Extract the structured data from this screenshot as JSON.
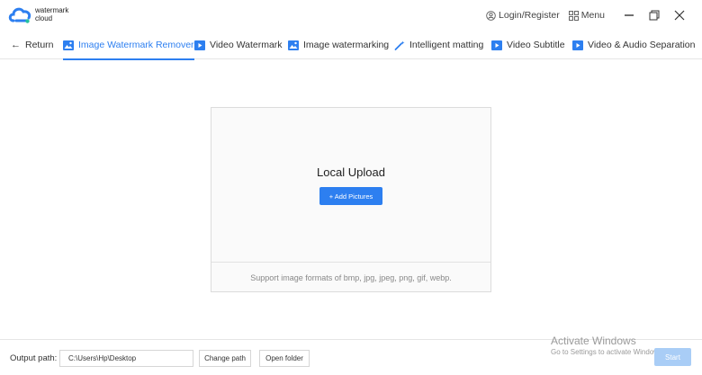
{
  "brand": {
    "line1": "watermark",
    "line2": "cloud",
    "color": "#2d7ff0"
  },
  "header": {
    "login_label": "Login/Register",
    "menu_label": "Menu"
  },
  "nav": {
    "return_label": "Return",
    "tabs": [
      {
        "label": "Image Watermark Remover",
        "icon": "image-icon",
        "active": true
      },
      {
        "label": "Video Watermark",
        "icon": "video-icon",
        "active": false
      },
      {
        "label": "Image watermarking",
        "icon": "image-icon",
        "active": false
      },
      {
        "label": "Intelligent matting",
        "icon": "magic-wand-icon",
        "active": false
      },
      {
        "label": "Video Subtitle",
        "icon": "video-icon",
        "active": false
      },
      {
        "label": "Video & Audio Separation",
        "icon": "video-icon",
        "active": false
      }
    ]
  },
  "upload": {
    "title": "Local Upload",
    "add_button": "+ Add Pictures",
    "support_text": "Support image formats of bmp, jpg, jpeg, png, gif, webp."
  },
  "footer": {
    "output_label": "Output path:",
    "output_path": "C:\\Users\\Hp\\Desktop",
    "change_path": "Change path",
    "open_folder": "Open folder",
    "start": "Start"
  },
  "activation": {
    "title": "Activate Windows",
    "subtitle": "Go to Settings to activate Windows."
  },
  "colors": {
    "accent": "#2d7ff0",
    "start_disabled": "#a9cdf6"
  }
}
